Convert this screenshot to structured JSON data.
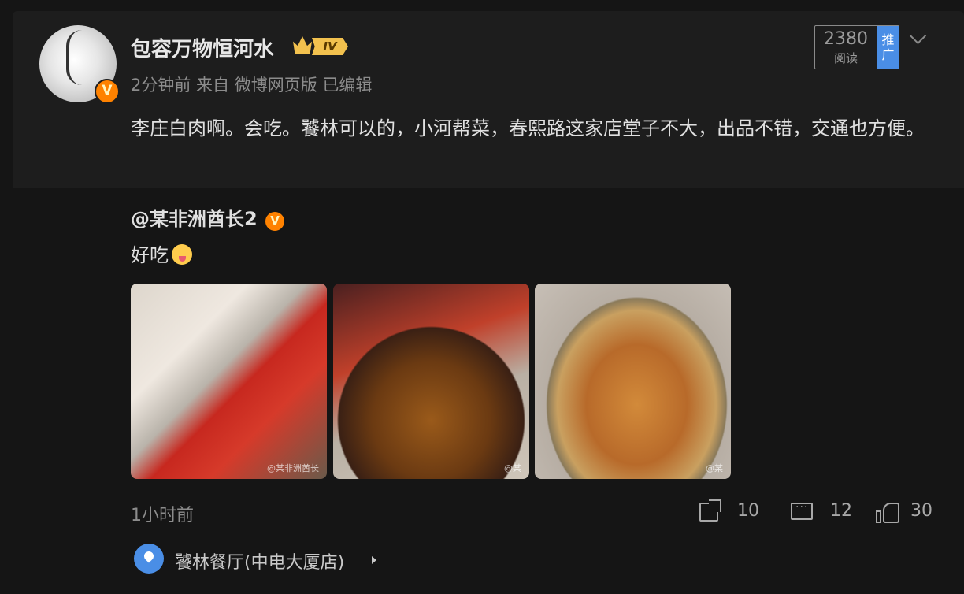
{
  "post": {
    "author": "包容万物恒河水",
    "level_badge": "IV",
    "meta": "2分钟前 来自 微博网页版 已编辑",
    "content": "李庄白肉啊。会吃。饕林可以的，小河帮菜，春熙路这家店堂子不大，出品不错，交通也方便。",
    "reads": "2380",
    "reads_label": "阅读",
    "promote_label": "推广",
    "verified_badge": "V"
  },
  "repost": {
    "author": "@某非洲酋长2",
    "text": "好吃",
    "emoji": "yum-face-emoji",
    "photos": [
      {
        "name": "photo-lizhuang-pork",
        "watermark": "@某非洲酋长"
      },
      {
        "name": "photo-stew-pot",
        "watermark": "@某"
      },
      {
        "name": "photo-chicken-dish",
        "watermark": "@某"
      }
    ],
    "time": "1小时前",
    "actions": {
      "share": "10",
      "comment": "12",
      "like": "30"
    },
    "location": "饕林餐厅(中电大厦店)"
  },
  "colors": {
    "accent": "#4a8ee6",
    "verified": "#ff8200",
    "level": "#f2c14e",
    "background": "#1d1d1d"
  }
}
